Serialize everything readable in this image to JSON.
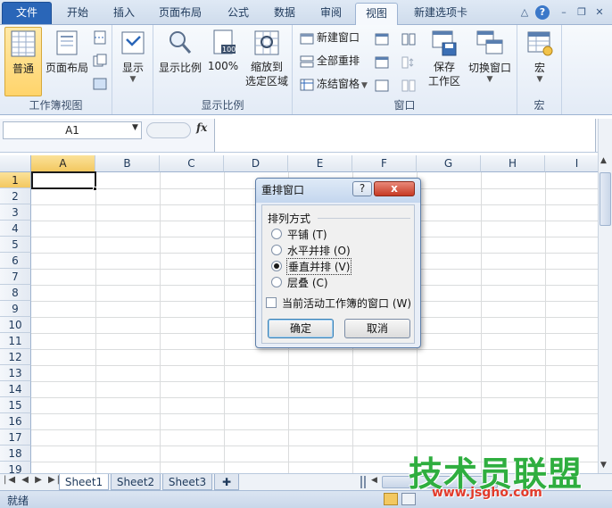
{
  "tabs": [
    {
      "id": "file",
      "label": "文件"
    },
    {
      "id": "home",
      "label": "开始"
    },
    {
      "id": "insert",
      "label": "插入"
    },
    {
      "id": "layout",
      "label": "页面布局"
    },
    {
      "id": "formula",
      "label": "公式"
    },
    {
      "id": "data",
      "label": "数据"
    },
    {
      "id": "review",
      "label": "审阅"
    },
    {
      "id": "view",
      "label": "视图"
    },
    {
      "id": "newtab",
      "label": "新建选项卡"
    }
  ],
  "ribbon": {
    "groups": {
      "workbook_views": "工作簿视图",
      "zoom": "显示比例",
      "window": "窗口",
      "macro": "宏"
    },
    "buttons": {
      "normal": "普通",
      "page_layout": "页面布局",
      "show": "显示",
      "zoom": "显示比例",
      "zoom100": "100%",
      "zoom_selection_1": "缩放到",
      "zoom_selection_2": "选定区域",
      "new_window": "新建窗口",
      "arrange_all": "全部重排",
      "freeze_panes": "冻结窗格",
      "save_workspace_1": "保存",
      "save_workspace_2": "工作区",
      "switch_windows": "切换窗口",
      "macros": "宏"
    }
  },
  "formula_bar": {
    "name_box": "A1",
    "fx": "fx"
  },
  "grid": {
    "columns": [
      "A",
      "B",
      "C",
      "D",
      "E",
      "F",
      "G",
      "H",
      "I"
    ],
    "rows": [
      "1",
      "2",
      "3",
      "4",
      "5",
      "6",
      "7",
      "8",
      "9",
      "10",
      "11",
      "12",
      "13",
      "14",
      "15",
      "16",
      "17",
      "18",
      "19"
    ],
    "selected_cell": "A1"
  },
  "sheets": [
    "Sheet1",
    "Sheet2",
    "Sheet3"
  ],
  "status": {
    "ready": "就绪"
  },
  "dialog": {
    "title": "重排窗口",
    "help": "?",
    "close": "x",
    "section": "排列方式",
    "options": [
      {
        "label": "平铺 (T)",
        "checked": false
      },
      {
        "label": "水平并排 (O)",
        "checked": false
      },
      {
        "label": "垂直并排 (V)",
        "checked": true
      },
      {
        "label": "层叠 (C)",
        "checked": false
      }
    ],
    "active_only": "当前活动工作簿的窗口 (W)",
    "ok": "确定",
    "cancel": "取消"
  },
  "watermark": {
    "main": "技术员联盟",
    "url": "www.jsgho.com"
  },
  "colors": {
    "file_tab": "#2a66b8",
    "selected_fill": "#ffd46b",
    "watermark_green": "#2fae3f"
  }
}
